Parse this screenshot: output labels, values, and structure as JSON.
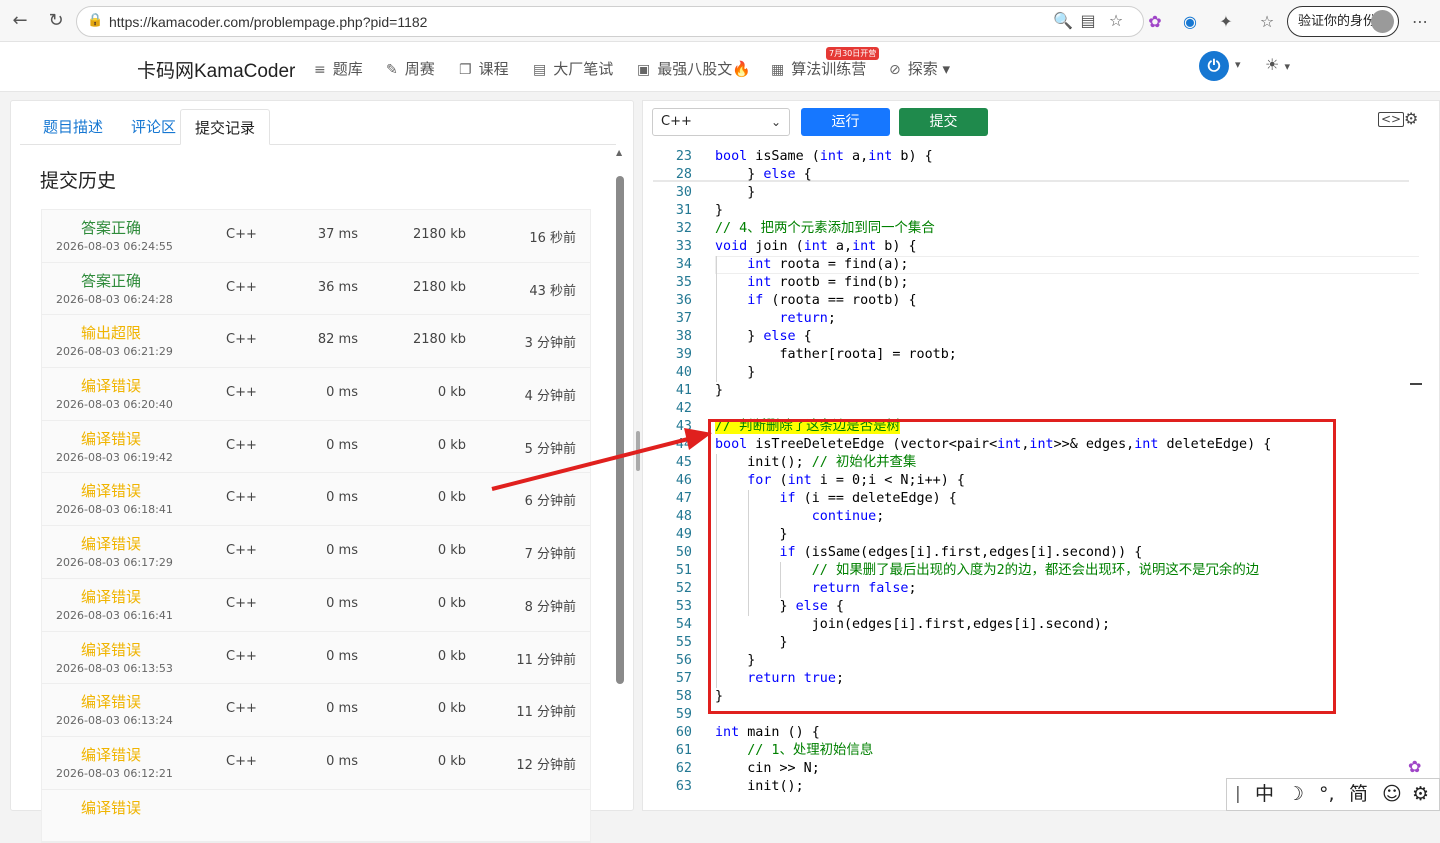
{
  "browser": {
    "url": "https://kamacoder.com/problempage.php?pid=1182",
    "verify_label": "验证你的身份"
  },
  "site": {
    "logo": "卡码网KamaCoder",
    "nav": [
      {
        "icon": "list-icon",
        "label": "题库"
      },
      {
        "icon": "pencil-icon",
        "label": "周赛"
      },
      {
        "icon": "book-icon",
        "label": "课程"
      },
      {
        "icon": "notebook-icon",
        "label": "大厂笔试"
      },
      {
        "icon": "document-icon",
        "label": "最强八股文🔥"
      },
      {
        "icon": "calendar-icon",
        "label": "算法训练营"
      },
      {
        "icon": "compass-icon",
        "label": "探索 ▾"
      }
    ],
    "nav_badge": "7月30日开营"
  },
  "left": {
    "tabs": [
      "题目描述",
      "评论区",
      "提交记录"
    ],
    "active_tab": 2,
    "history_title": "提交历史",
    "rows": [
      {
        "status": "答案正确",
        "color": "#2e8b3a",
        "time": "2026-08-03 06:24:55",
        "lang": "C++",
        "runtime": "37 ms",
        "memory": "2180 kb",
        "ago": "16 秒前"
      },
      {
        "status": "答案正确",
        "color": "#2e8b3a",
        "time": "2026-08-03 06:24:28",
        "lang": "C++",
        "runtime": "36 ms",
        "memory": "2180 kb",
        "ago": "43 秒前"
      },
      {
        "status": "输出超限",
        "color": "#f0b400",
        "time": "2026-08-03 06:21:29",
        "lang": "C++",
        "runtime": "82 ms",
        "memory": "2180 kb",
        "ago": "3 分钟前"
      },
      {
        "status": "编译错误",
        "color": "#f0b400",
        "time": "2026-08-03 06:20:40",
        "lang": "C++",
        "runtime": "0 ms",
        "memory": "0 kb",
        "ago": "4 分钟前"
      },
      {
        "status": "编译错误",
        "color": "#f0b400",
        "time": "2026-08-03 06:19:42",
        "lang": "C++",
        "runtime": "0 ms",
        "memory": "0 kb",
        "ago": "5 分钟前"
      },
      {
        "status": "编译错误",
        "color": "#f0b400",
        "time": "2026-08-03 06:18:41",
        "lang": "C++",
        "runtime": "0 ms",
        "memory": "0 kb",
        "ago": "6 分钟前"
      },
      {
        "status": "编译错误",
        "color": "#f0b400",
        "time": "2026-08-03 06:17:29",
        "lang": "C++",
        "runtime": "0 ms",
        "memory": "0 kb",
        "ago": "7 分钟前"
      },
      {
        "status": "编译错误",
        "color": "#f0b400",
        "time": "2026-08-03 06:16:41",
        "lang": "C++",
        "runtime": "0 ms",
        "memory": "0 kb",
        "ago": "8 分钟前"
      },
      {
        "status": "编译错误",
        "color": "#f0b400",
        "time": "2026-08-03 06:13:53",
        "lang": "C++",
        "runtime": "0 ms",
        "memory": "0 kb",
        "ago": "11 分钟前"
      },
      {
        "status": "编译错误",
        "color": "#f0b400",
        "time": "2026-08-03 06:13:24",
        "lang": "C++",
        "runtime": "0 ms",
        "memory": "0 kb",
        "ago": "11 分钟前"
      },
      {
        "status": "编译错误",
        "color": "#f0b400",
        "time": "2026-08-03 06:12:21",
        "lang": "C++",
        "runtime": "0 ms",
        "memory": "0 kb",
        "ago": "12 分钟前"
      },
      {
        "status": "编译错误",
        "color": "#f0b400",
        "time": "",
        "lang": "",
        "runtime": "",
        "memory": "",
        "ago": ""
      }
    ]
  },
  "editor": {
    "language": "C++",
    "run_label": "运行",
    "submit_label": "提交",
    "lines": [
      {
        "n": "23",
        "html": "<span class='kw'>bool</span> isSame (<span class='kw'>int</span> a,<span class='kw'>int</span> b) {"
      },
      {
        "n": "28",
        "html": "    } <span class='kw'>else</span> {"
      },
      {
        "n": "30",
        "html": "    }"
      },
      {
        "n": "31",
        "html": "}"
      },
      {
        "n": "32",
        "html": "<span class='cm'>// 4、把两个元素添加到同一个集合</span>"
      },
      {
        "n": "33",
        "html": "<span class='kw'>void</span> join (<span class='kw'>int</span> a,<span class='kw'>int</span> b) {"
      },
      {
        "n": "34",
        "html": "    <span class='kw'>int</span> roota = find(a);"
      },
      {
        "n": "35",
        "html": "    <span class='kw'>int</span> rootb = find(b);"
      },
      {
        "n": "36",
        "html": "    <span class='kw'>if</span> (roota == rootb) {"
      },
      {
        "n": "37",
        "html": "        <span class='kw'>return</span>;"
      },
      {
        "n": "38",
        "html": "    } <span class='kw'>else</span> {"
      },
      {
        "n": "39",
        "html": "        father[roota] = rootb;"
      },
      {
        "n": "40",
        "html": "    }"
      },
      {
        "n": "41",
        "html": "}"
      },
      {
        "n": "42",
        "html": ""
      },
      {
        "n": "43",
        "html": "<span class='cm hl'>// 判断删除了这条边是否是树</span>"
      },
      {
        "n": "44",
        "html": "<span class='kw'>bool</span> isTreeDeleteEdge (vector&lt;pair&lt;<span class='kw'>int</span>,<span class='kw'>int</span>&gt;&gt;&amp; edges,<span class='kw'>int</span> deleteEdge) {"
      },
      {
        "n": "45",
        "html": "    init(); <span class='cm'>// 初始化并查集</span>"
      },
      {
        "n": "46",
        "html": "    <span class='kw'>for</span> (<span class='kw'>int</span> i = 0;i &lt; N;i++) {"
      },
      {
        "n": "47",
        "html": "        <span class='kw'>if</span> (i == deleteEdge) {"
      },
      {
        "n": "48",
        "html": "            <span class='kw'>continue</span>;"
      },
      {
        "n": "49",
        "html": "        }"
      },
      {
        "n": "50",
        "html": "        <span class='kw'>if</span> (isSame(edges[i].first,edges[i].second)) {"
      },
      {
        "n": "51",
        "html": "            <span class='cm'>// 如果删了最后出现的入度为2的边，都还会出现环，说明这不是冗余的边</span>"
      },
      {
        "n": "52",
        "html": "            <span class='kw'>return</span> <span class='kw'>false</span>;"
      },
      {
        "n": "53",
        "html": "        } <span class='kw'>else</span> {"
      },
      {
        "n": "54",
        "html": "            join(edges[i].first,edges[i].second);"
      },
      {
        "n": "55",
        "html": "        }"
      },
      {
        "n": "56",
        "html": "    }"
      },
      {
        "n": "57",
        "html": "    <span class='kw'>return</span> <span class='kw'>true</span>;"
      },
      {
        "n": "58",
        "html": "}"
      },
      {
        "n": "59",
        "html": ""
      },
      {
        "n": "60",
        "html": "<span class='kw'>int</span> main () {"
      },
      {
        "n": "61",
        "html": "    <span class='cm'>// 1、处理初始信息</span>"
      },
      {
        "n": "62",
        "html": "    cin &gt;&gt; N;"
      },
      {
        "n": "63",
        "html": "    init();"
      }
    ]
  },
  "ime": {
    "items": [
      "中",
      "☽",
      "°,",
      "简",
      "☺",
      "⚙"
    ]
  }
}
